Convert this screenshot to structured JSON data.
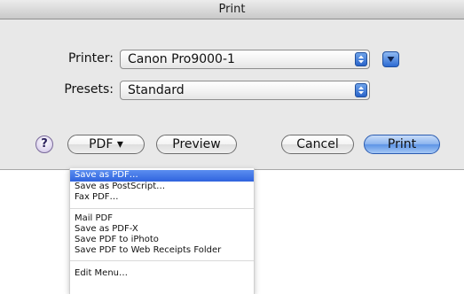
{
  "dialog": {
    "title": "Print",
    "printer": {
      "label": "Printer:",
      "value": "Canon Pro9000-1"
    },
    "presets": {
      "label": "Presets:",
      "value": "Standard"
    },
    "buttons": {
      "help": "?",
      "pdf": "PDF ▾",
      "preview": "Preview",
      "cancel": "Cancel",
      "print": "Print"
    }
  },
  "pdf_menu": {
    "items": [
      "Save as PDF…",
      "Save as PostScript…",
      "Fax PDF…",
      "Mail PDF",
      "Save as PDF-X",
      "Save PDF to iPhoto",
      "Save PDF to Web Receipts Folder",
      "Edit Menu…"
    ]
  }
}
